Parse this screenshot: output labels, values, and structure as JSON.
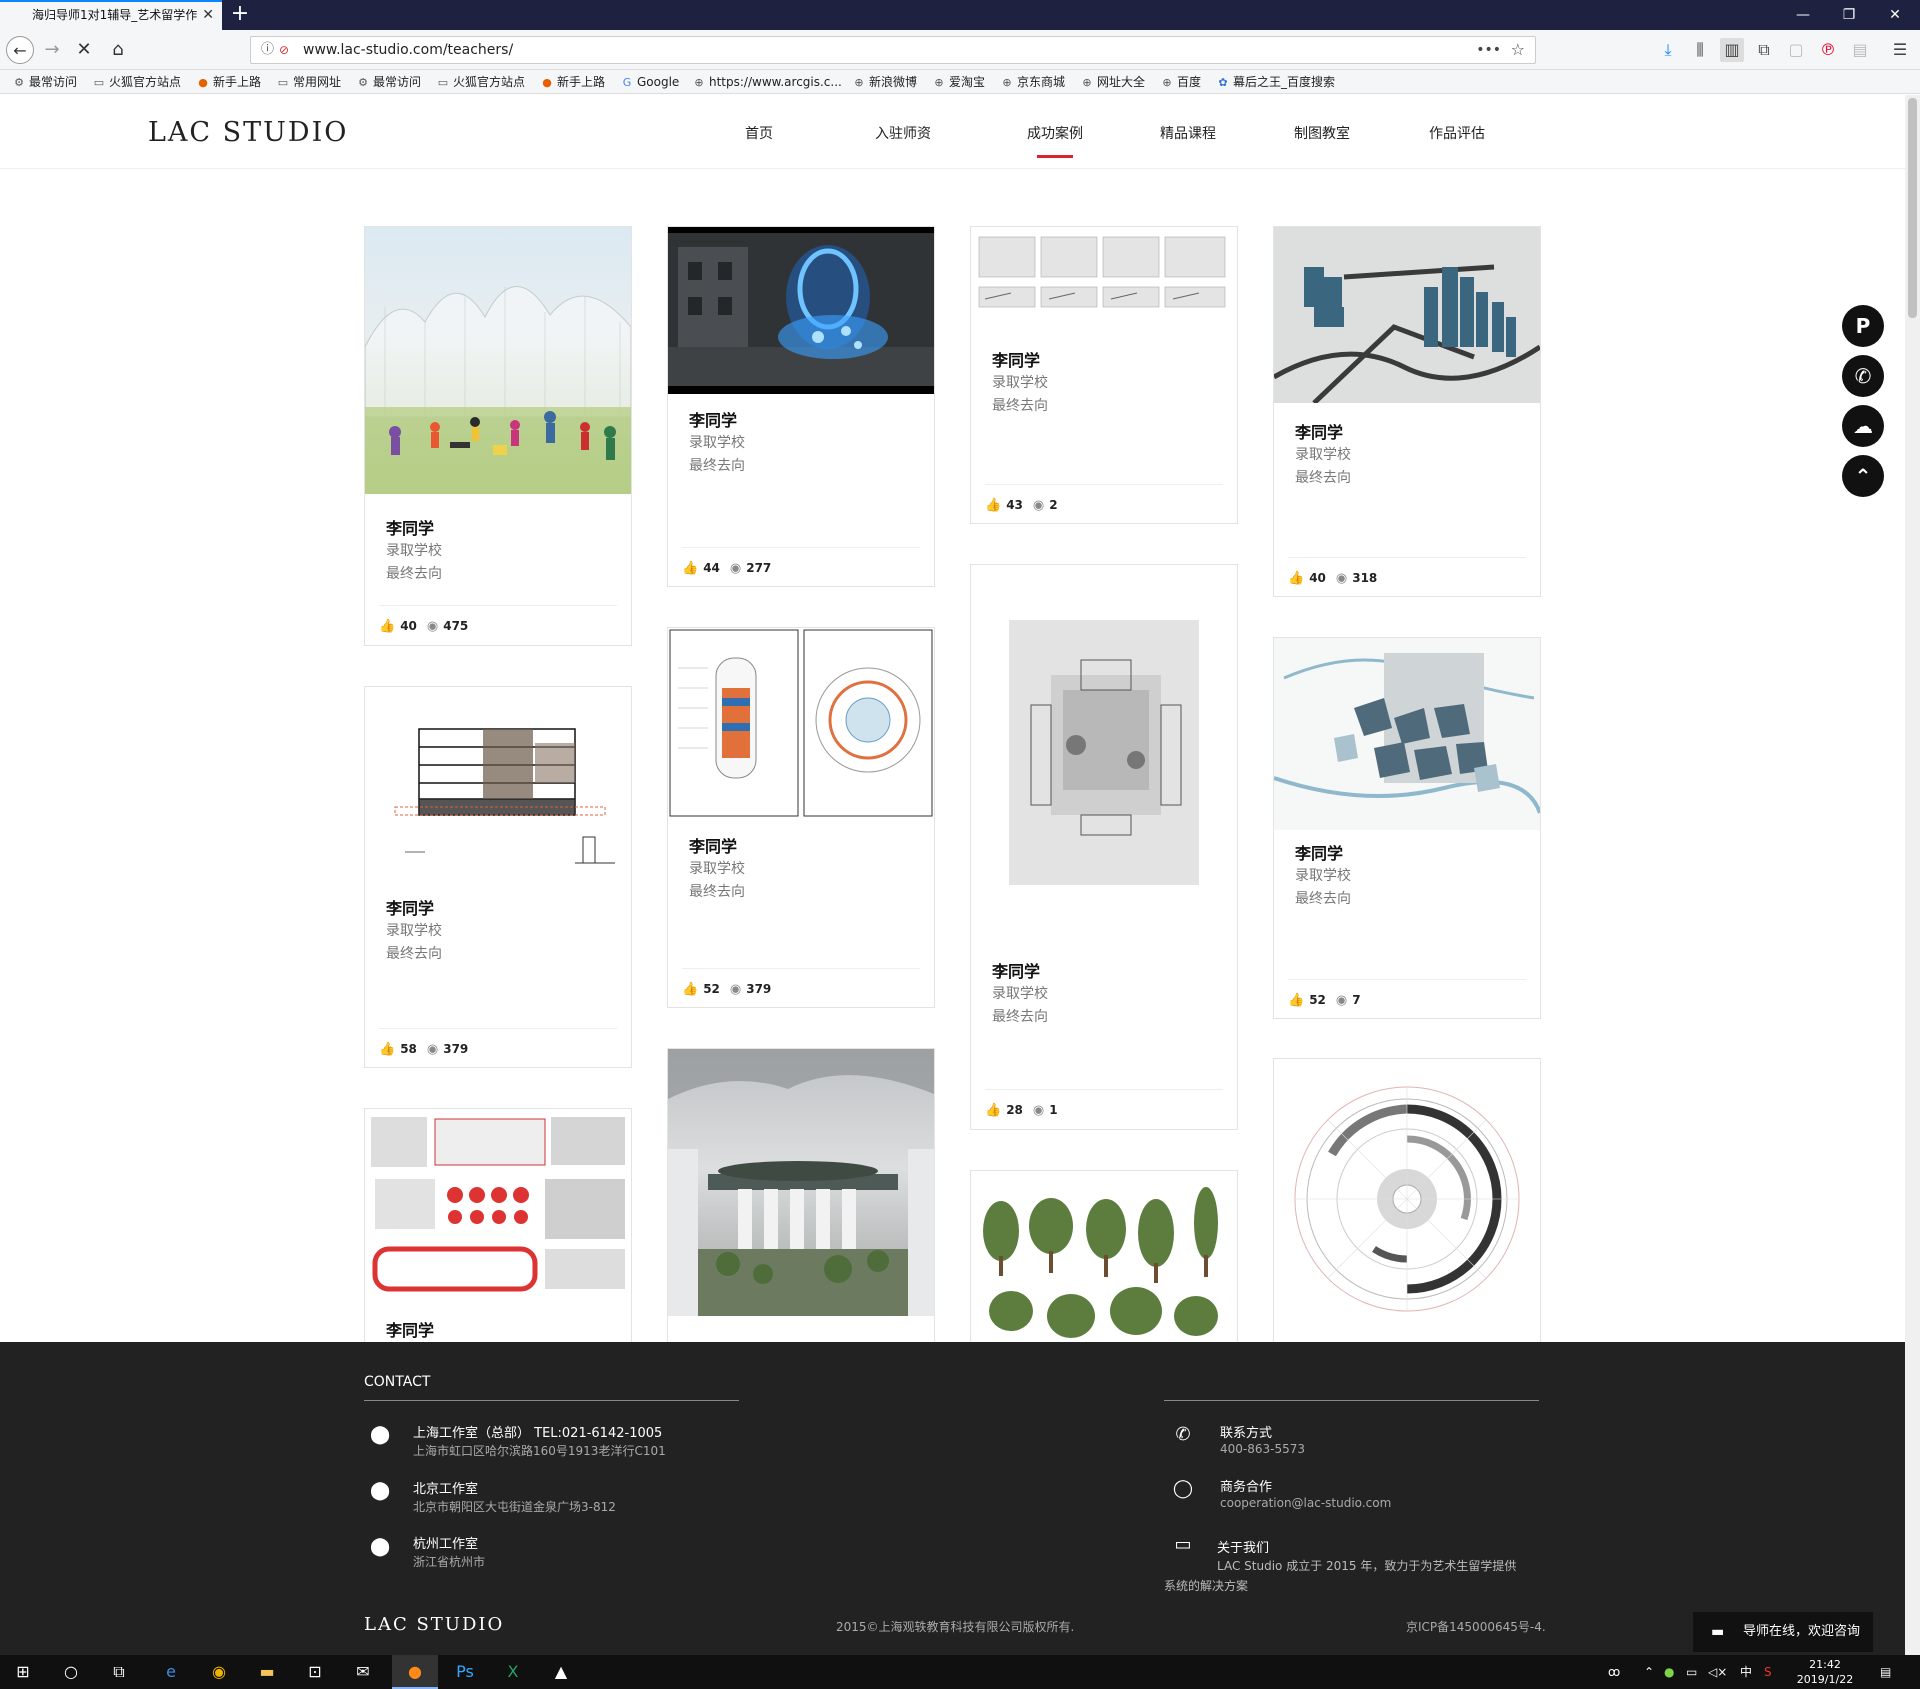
{
  "browser": {
    "tab_title": "海归导师1对1辅导_艺术留学作",
    "tab_close": "✕",
    "new_tab": "+",
    "url": "www.lac-studio.com/teachers/",
    "window_controls": [
      "—",
      "❐",
      "✕"
    ],
    "bookmarks": [
      {
        "icon": "gear-icon",
        "label": "最常访问"
      },
      {
        "icon": "folder-icon",
        "label": "火狐官方站点"
      },
      {
        "icon": "firefox-icon",
        "label": "新手上路"
      },
      {
        "icon": "folder-icon",
        "label": "常用网址"
      },
      {
        "icon": "gear-icon",
        "label": "最常访问"
      },
      {
        "icon": "folder-icon",
        "label": "火狐官方站点"
      },
      {
        "icon": "firefox-icon",
        "label": "新手上路"
      },
      {
        "icon": "google-icon",
        "label": "Google"
      },
      {
        "icon": "globe-icon",
        "label": "https://www.arcgis.c..."
      },
      {
        "icon": "globe-icon",
        "label": "新浪微博"
      },
      {
        "icon": "globe-icon",
        "label": "爱淘宝"
      },
      {
        "icon": "globe-icon",
        "label": "京东商城"
      },
      {
        "icon": "globe-icon",
        "label": "网址大全"
      },
      {
        "icon": "globe-icon",
        "label": "百度"
      },
      {
        "icon": "baidu-icon",
        "label": "幕后之王_百度搜索"
      }
    ]
  },
  "site": {
    "logo": "LAC STUDIO",
    "nav": [
      "首页",
      "入驻师资",
      "成功案例",
      "精品课程",
      "制图教室",
      "作品评估"
    ],
    "active_nav": "成功案例",
    "accent_color": "#d7262b"
  },
  "cards": [
    {
      "name": "李同学",
      "school": "录取学校",
      "dest": "最终去向",
      "likes": "40",
      "views": "475"
    },
    {
      "name": "李同学",
      "school": "录取学校",
      "dest": "最终去向",
      "likes": "58",
      "views": "379"
    },
    {
      "name": "李同学",
      "school": "",
      "dest": "",
      "likes": "",
      "views": ""
    },
    {
      "name": "李同学",
      "school": "录取学校",
      "dest": "最终去向",
      "likes": "44",
      "views": "277"
    },
    {
      "name": "李同学",
      "school": "录取学校",
      "dest": "最终去向",
      "likes": "52",
      "views": "379"
    },
    {
      "name": "",
      "school": "",
      "dest": "",
      "likes": "",
      "views": ""
    },
    {
      "name": "李同学",
      "school": "录取学校",
      "dest": "最终去向",
      "likes": "43",
      "views": "2"
    },
    {
      "name": "李同学",
      "school": "录取学校",
      "dest": "最终去向",
      "likes": "28",
      "views": "1"
    },
    {
      "name": "",
      "school": "",
      "dest": "",
      "likes": "",
      "views": ""
    },
    {
      "name": "李同学",
      "school": "录取学校",
      "dest": "最终去向",
      "likes": "40",
      "views": "318"
    },
    {
      "name": "李同学",
      "school": "录取学校",
      "dest": "最终去向",
      "likes": "52",
      "views": "7"
    },
    {
      "name": "",
      "school": "",
      "dest": "",
      "likes": "",
      "views": ""
    }
  ],
  "float_buttons": [
    "pinterest-icon",
    "phone-icon",
    "cloud-upload-icon",
    "back-to-top-icon"
  ],
  "footer": {
    "contact_title": "CONTACT",
    "offices": [
      {
        "title": "上海工作室（总部）  TEL:021-6142-1005",
        "address": "上海市虹口区哈尔滨路160号1913老洋行C101"
      },
      {
        "title": "北京工作室",
        "address": "北京市朝阳区大屯街道金泉广场3-812"
      },
      {
        "title": "杭州工作室",
        "address": "浙江省杭州市"
      }
    ],
    "contact_label": "联系方式",
    "contact_phone": "400-863-5573",
    "biz_label": "商务合作",
    "biz_email": "cooperation@lac-studio.com",
    "about_label": "关于我们",
    "about_line1": "LAC Studio 成立于 2015 年，致力于为艺术生留学提供",
    "about_line2": "系统的解决方案",
    "logo": "LAC STUDIO",
    "copyright": "2015©上海观轶教育科技有限公司版权所有.",
    "icp": "京ICP备145000645号-4."
  },
  "chat": {
    "label": "导师在线，欢迎咨询"
  },
  "taskbar": {
    "ime": "中",
    "time": "21:42",
    "date": "2019/1/22"
  }
}
